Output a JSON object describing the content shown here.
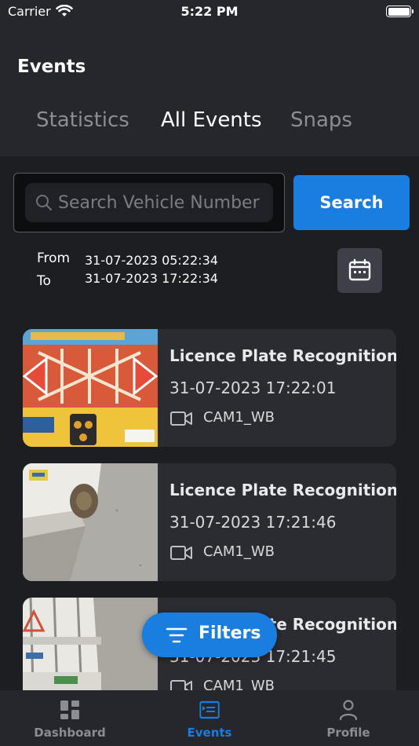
{
  "status_bar": {
    "carrier": "Carrier",
    "time": "5:22 PM"
  },
  "header": {
    "title": "Events"
  },
  "tabs": [
    {
      "label": "Statistics",
      "active": false
    },
    {
      "label": "All Events",
      "active": true
    },
    {
      "label": "Snaps",
      "active": false
    }
  ],
  "search": {
    "placeholder": "Search Vehicle Number",
    "value": "",
    "button_label": "Search"
  },
  "date_range": {
    "from_label": "From",
    "from_value": "31-07-2023 05:22:34",
    "to_label": "To",
    "to_value": "31-07-2023 17:22:34"
  },
  "events": [
    {
      "title": "Licence Plate Recognition",
      "timestamp": "31-07-2023 17:22:01",
      "camera": "CAM1_WB"
    },
    {
      "title": "Licence Plate Recognition",
      "timestamp": "31-07-2023 17:21:46",
      "camera": "CAM1_WB"
    },
    {
      "title": "Licence Plate Recognition",
      "timestamp": "31-07-2023 17:21:45",
      "camera": "CAM1_WB"
    }
  ],
  "filters_button": {
    "label": "Filters"
  },
  "bottom_nav": [
    {
      "label": "Dashboard",
      "icon": "dashboard-icon",
      "active": false
    },
    {
      "label": "Events",
      "icon": "events-icon",
      "active": true
    },
    {
      "label": "Profile",
      "icon": "profile-icon",
      "active": false
    }
  ],
  "colors": {
    "accent": "#1a7de0",
    "background": "#1c1e22",
    "card": "#2a2c32"
  }
}
